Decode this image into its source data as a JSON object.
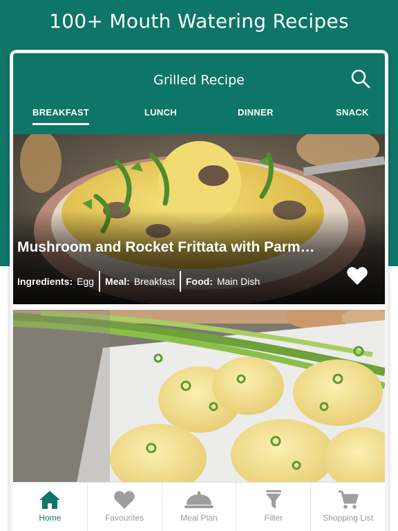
{
  "promo": {
    "headline": "100+ Mouth Watering Recipes"
  },
  "header": {
    "title": "Grilled Recipe",
    "search_icon": "search-icon"
  },
  "tabs": [
    {
      "label": "BREAKFAST",
      "active": true
    },
    {
      "label": "LUNCH",
      "active": false
    },
    {
      "label": "DINNER",
      "active": false
    },
    {
      "label": "SNACK",
      "active": false
    }
  ],
  "recipes": [
    {
      "title": "Mushroom and Rocket Frittata with Parm…",
      "ingredients_label": "Ingredients:",
      "ingredients_value": "Egg",
      "meal_label": "Meal:",
      "meal_value": "Breakfast",
      "food_label": "Food:",
      "food_value": "Main Dish",
      "favourite_icon": "heart-icon"
    }
  ],
  "bottom_nav": [
    {
      "label": "Home",
      "icon": "home-icon",
      "active": true
    },
    {
      "label": "Favourites",
      "icon": "heart-icon",
      "active": false
    },
    {
      "label": "Meal Plan",
      "icon": "cloche-icon",
      "active": false
    },
    {
      "label": "Filter",
      "icon": "filter-icon",
      "active": false
    },
    {
      "label": "Shopping List",
      "icon": "cart-icon",
      "active": false
    }
  ],
  "colors": {
    "primary": "#0e7669",
    "inactive": "#999999",
    "white": "#ffffff"
  }
}
